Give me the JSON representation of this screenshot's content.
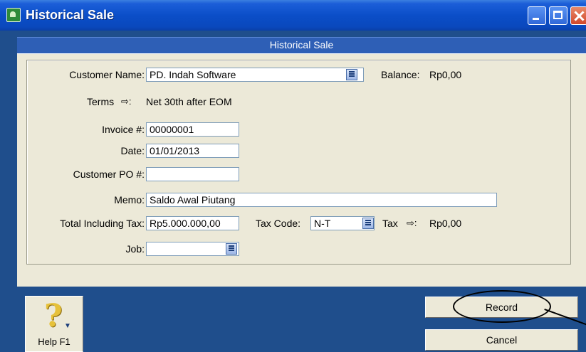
{
  "window": {
    "title": "Historical Sale"
  },
  "section_header": "Historical Sale",
  "form": {
    "customer_name_label": "Customer Name:",
    "customer_name_value": "PD. Indah Software",
    "balance_label": "Balance:",
    "balance_value": "Rp0,00",
    "terms_label": "Terms",
    "terms_arrow": "⇨:",
    "terms_value": "Net 30th after EOM",
    "invoice_label": "Invoice #:",
    "invoice_value": "00000001",
    "date_label": "Date:",
    "date_value": "01/01/2013",
    "customer_po_label": "Customer PO #:",
    "customer_po_value": "",
    "memo_label": "Memo:",
    "memo_value": "Saldo Awal Piutang",
    "total_label": "Total Including Tax:",
    "total_value": "Rp5.000.000,00",
    "tax_code_label": "Tax Code:",
    "tax_code_value": "N-T",
    "tax_label": "Tax",
    "tax_arrow": "⇨:",
    "tax_value": "Rp0,00",
    "job_label": "Job:",
    "job_value": ""
  },
  "buttons": {
    "help_label": "Help F1",
    "help_glyph": "?",
    "help_down": "▼",
    "record_label": "Record",
    "cancel_label": "Cancel"
  },
  "icons": {
    "app": "app-icon",
    "minimize": "minimize-icon",
    "maximize": "maximize-icon",
    "close": "close-icon",
    "help": "question-mark-icon"
  },
  "colors": {
    "titlebar": "#0b4ec8",
    "background": "#1f4e8c",
    "panel": "#ece9d8",
    "help_glyph": "#e6c13a"
  }
}
